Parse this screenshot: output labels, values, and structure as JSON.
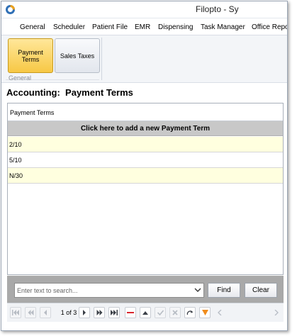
{
  "window": {
    "title": "Filopto - Sy"
  },
  "menu": {
    "items": [
      "General",
      "Scheduler",
      "Patient File",
      "EMR",
      "Dispensing",
      "Task Manager",
      "Office Repor"
    ]
  },
  "ribbon": {
    "buttons": [
      {
        "label": "Payment Terms",
        "active": true
      },
      {
        "label": "Sales Taxes",
        "active": false
      }
    ],
    "group_label": "General"
  },
  "page": {
    "title": "Accounting:  Payment Terms"
  },
  "grid": {
    "header": "Payment Terms",
    "add_row_label": "Click here to add a new Payment Term",
    "rows": [
      "2/10",
      "5/10",
      "N/30"
    ]
  },
  "search": {
    "placeholder": "Enter text to search...",
    "find_label": "Find",
    "clear_label": "Clear"
  },
  "navigator": {
    "page_text": "1 of 3"
  },
  "colors": {
    "active_button": "#f7c845",
    "row_highlight": "#ffffdf",
    "add_row_bg": "#c8c8c8",
    "search_area_bg": "#a9a9a9",
    "delete_icon": "#d9262e",
    "filter_icon": "#f08c1d"
  },
  "icons": {
    "nav": [
      "first-page-icon",
      "previous-page-icon",
      "previous-icon",
      "next-icon",
      "next-page-icon",
      "last-page-icon",
      "delete-icon",
      "move-up-icon",
      "accept-icon",
      "cancel-icon",
      "refresh-icon",
      "filter-icon",
      "scroll-left-icon",
      "scroll-right-icon"
    ]
  }
}
